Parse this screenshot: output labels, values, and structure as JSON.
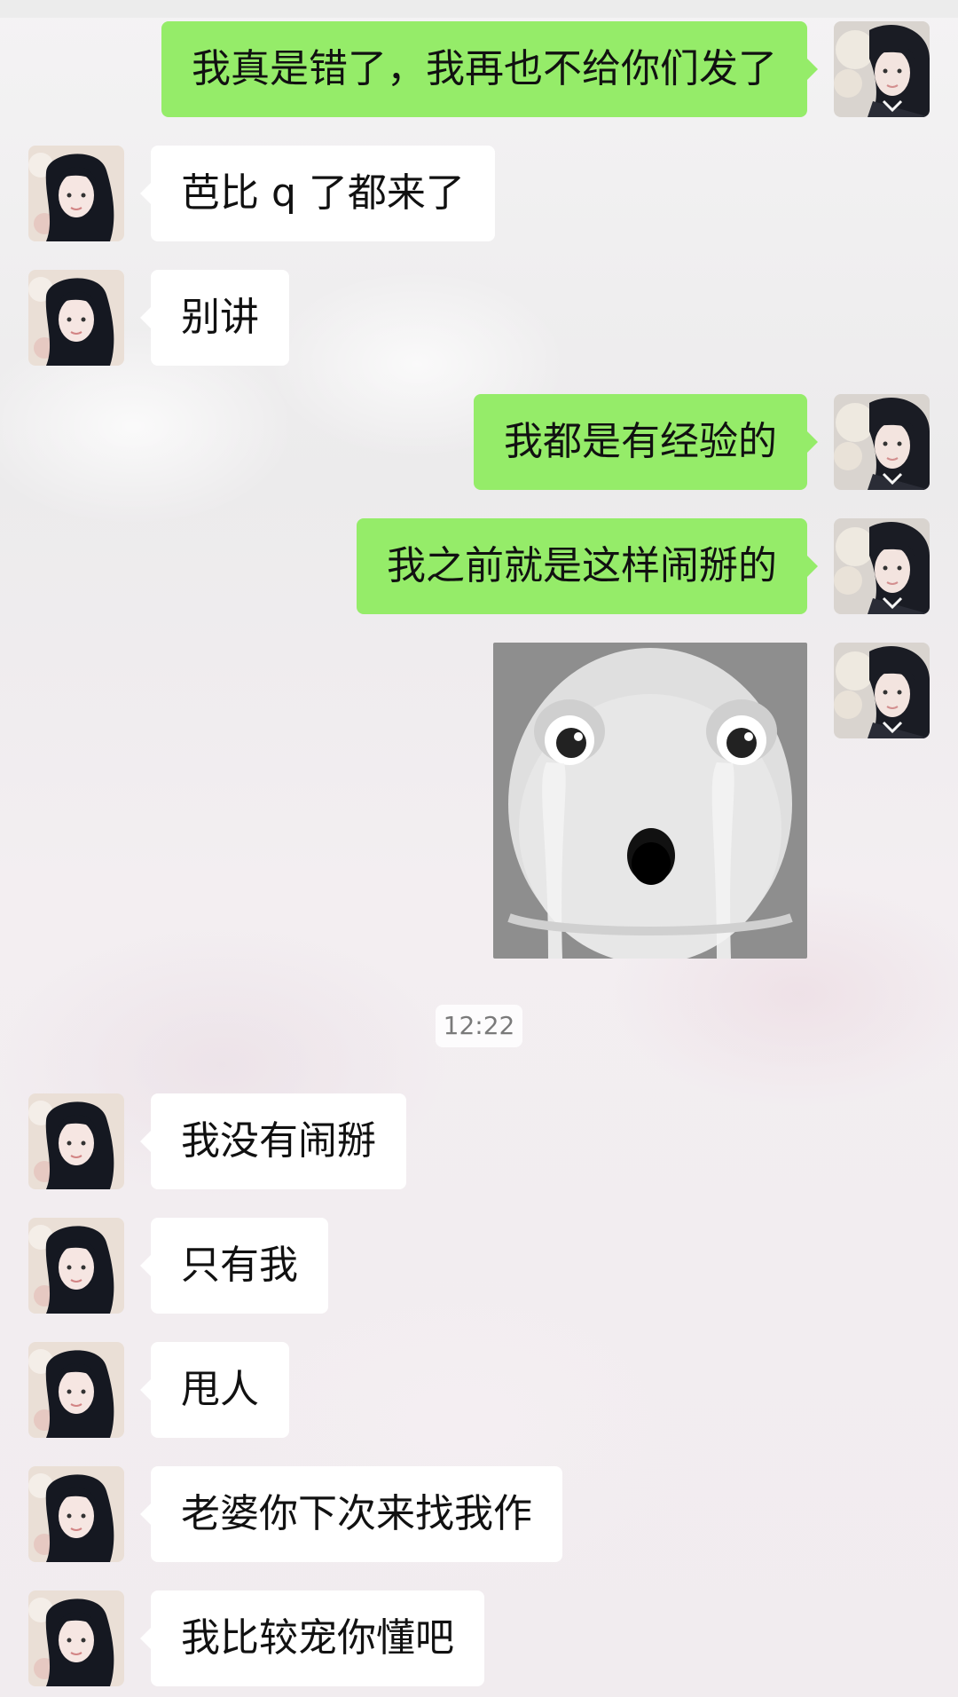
{
  "theme": {
    "incoming_bubble": "#ffffff",
    "outgoing_bubble": "#95ec69",
    "text": "#111111",
    "time_text": "#7a7a7a"
  },
  "avatars": {
    "self": "girl-profile-avatar-right",
    "other": "girl-profile-avatar-left"
  },
  "messages": [
    {
      "side": "out",
      "text": "我真是错了，我再也不给你们发了"
    },
    {
      "side": "in",
      "text": "芭比 q 了都来了"
    },
    {
      "side": "in",
      "text": "别讲"
    },
    {
      "side": "out",
      "text": "我都是有经验的"
    },
    {
      "side": "out",
      "text": "我之前就是这样闹掰的"
    },
    {
      "side": "out",
      "type": "sticker",
      "sticker": "crying-white-character-sticker"
    },
    {
      "side": "in",
      "text": "我没有闹掰"
    },
    {
      "side": "in",
      "text": "只有我"
    },
    {
      "side": "in",
      "text": "甩人"
    },
    {
      "side": "in",
      "text": "老婆你下次来找我作"
    },
    {
      "side": "in",
      "text": "我比较宠你懂吧"
    }
  ],
  "timestamp": "12:22"
}
